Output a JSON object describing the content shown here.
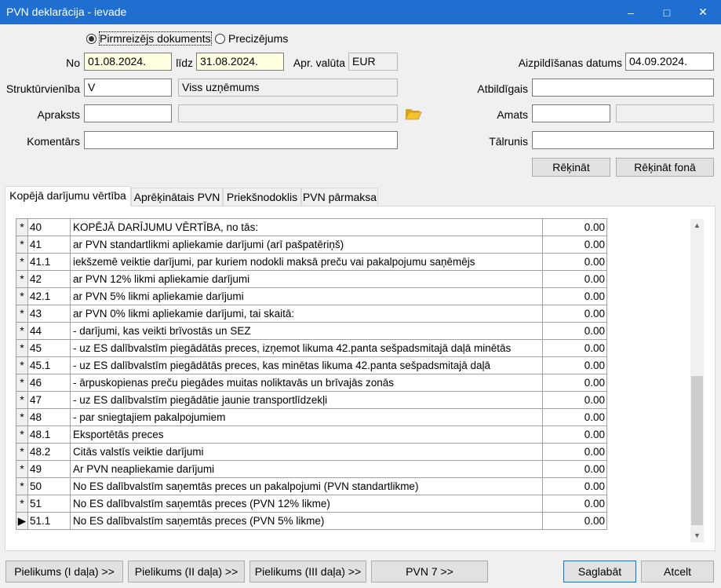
{
  "window": {
    "title": "PVN deklarācija - ievade",
    "minimize": "–",
    "maximize": "□",
    "close": "✕"
  },
  "doc_type": {
    "options": [
      "Pirmreizējs dokuments",
      "Precizējums"
    ],
    "selected": "Pirmreizējs dokuments"
  },
  "form": {
    "no_label": "No",
    "no_value": "01.08.2024.",
    "lidz_label": "līdz",
    "lidz_value": "31.08.2024.",
    "currency_label": "Apr. valūta",
    "currency_value": "EUR",
    "fill_date_label": "Aizpildīšanas datums",
    "fill_date_value": "04.09.2024.",
    "struct_label": "Struktūrvienība",
    "struct_code": "V",
    "struct_name": "Viss uzņēmums",
    "responsible_label": "Atbildīgais",
    "responsible_value": "",
    "description_label": "Apraksts",
    "description_value": "",
    "description_extra": "",
    "position_label": "Amats",
    "position_value": "",
    "position_extra": "",
    "comments_label": "Komentārs",
    "comments_value": "",
    "phone_label": "Tālrunis",
    "phone_value": ""
  },
  "actions": {
    "calculate": "Rēķināt",
    "calculate_background": "Rēķināt fonā"
  },
  "tabs": [
    "Kopējā darījumu vērtība",
    "Aprēķinātais PVN",
    "Priekšnodoklis",
    "PVN pārmaksa"
  ],
  "active_tab": 0,
  "grid": {
    "rows": [
      {
        "sel": "*",
        "code": "40",
        "desc": "KOPĒJĀ DARĪJUMU VĒRTĪBA, no tās:",
        "value": "0.00"
      },
      {
        "sel": "*",
        "code": "41",
        "desc": "ar PVN standartlikmi apliekamie darījumi (arī pašpatēriņš)",
        "value": "0.00"
      },
      {
        "sel": "*",
        "code": "41.1",
        "desc": "iekšzemē veiktie darījumi, par kuriem nodokli maksā preču vai pakalpojumu saņēmējs",
        "value": "0.00"
      },
      {
        "sel": "*",
        "code": "42",
        "desc": "ar PVN 12% likmi apliekamie darījumi",
        "value": "0.00"
      },
      {
        "sel": "*",
        "code": "42.1",
        "desc": "ar PVN 5% likmi apliekamie darījumi",
        "value": "0.00"
      },
      {
        "sel": "*",
        "code": "43",
        "desc": "ar PVN 0% likmi apliekamie darījumi, tai skaitā:",
        "value": "0.00"
      },
      {
        "sel": "*",
        "code": "44",
        "desc": "- darījumi, kas veikti brīvostās un SEZ",
        "value": "0.00"
      },
      {
        "sel": "*",
        "code": "45",
        "desc": "- uz ES dalībvalstīm piegādātās preces, izņemot likuma 42.panta sešpadsmitajā daļā minētās",
        "value": "0.00"
      },
      {
        "sel": "*",
        "code": "45.1",
        "desc": "- uz ES dalībvalstīm piegādātās preces, kas minētas likuma 42.panta sešpadsmitajā daļā",
        "value": "0.00"
      },
      {
        "sel": "*",
        "code": "46",
        "desc": "- ārpuskopienas preču piegādes muitas noliktavās un brīvajās zonās",
        "value": "0.00"
      },
      {
        "sel": "*",
        "code": "47",
        "desc": "- uz ES dalībvalstīm piegādātie jaunie transportlīdzekļi",
        "value": "0.00"
      },
      {
        "sel": "*",
        "code": "48",
        "desc": "- par sniegtajiem pakalpojumiem",
        "value": "0.00"
      },
      {
        "sel": "*",
        "code": "48.1",
        "desc": "Eksportētās preces",
        "value": "0.00"
      },
      {
        "sel": "*",
        "code": "48.2",
        "desc": "Citās valstīs veiktie darījumi",
        "value": "0.00"
      },
      {
        "sel": "*",
        "code": "49",
        "desc": "Ar PVN neapliekamie darījumi",
        "value": "0.00"
      },
      {
        "sel": "*",
        "code": "50",
        "desc": "No ES dalībvalstīm saņemtās preces un pakalpojumi (PVN standartlikme)",
        "value": "0.00"
      },
      {
        "sel": "*",
        "code": "51",
        "desc": "No ES dalībvalstīm saņemtās preces (PVN 12% likme)",
        "value": "0.00"
      },
      {
        "sel": "▶",
        "code": "51.1",
        "desc": "No ES dalībvalstīm saņemtās preces (PVN 5% likme)",
        "value": "0.00"
      }
    ]
  },
  "footer": {
    "buttons": [
      "Pielikums (I daļa) >>",
      "Pielikums (II daļa) >>",
      "Pielikums (III daļa) >>",
      "PVN 7 >>"
    ],
    "save": "Saglabāt",
    "cancel": "Atcelt"
  },
  "icons": {
    "folder": "folder-open-icon",
    "scroll_up": "▲",
    "scroll_down": "▼"
  },
  "colors": {
    "titlebar": "#1f6fd0",
    "date_field": "#ffffe1",
    "folder": "#e8b62c"
  }
}
